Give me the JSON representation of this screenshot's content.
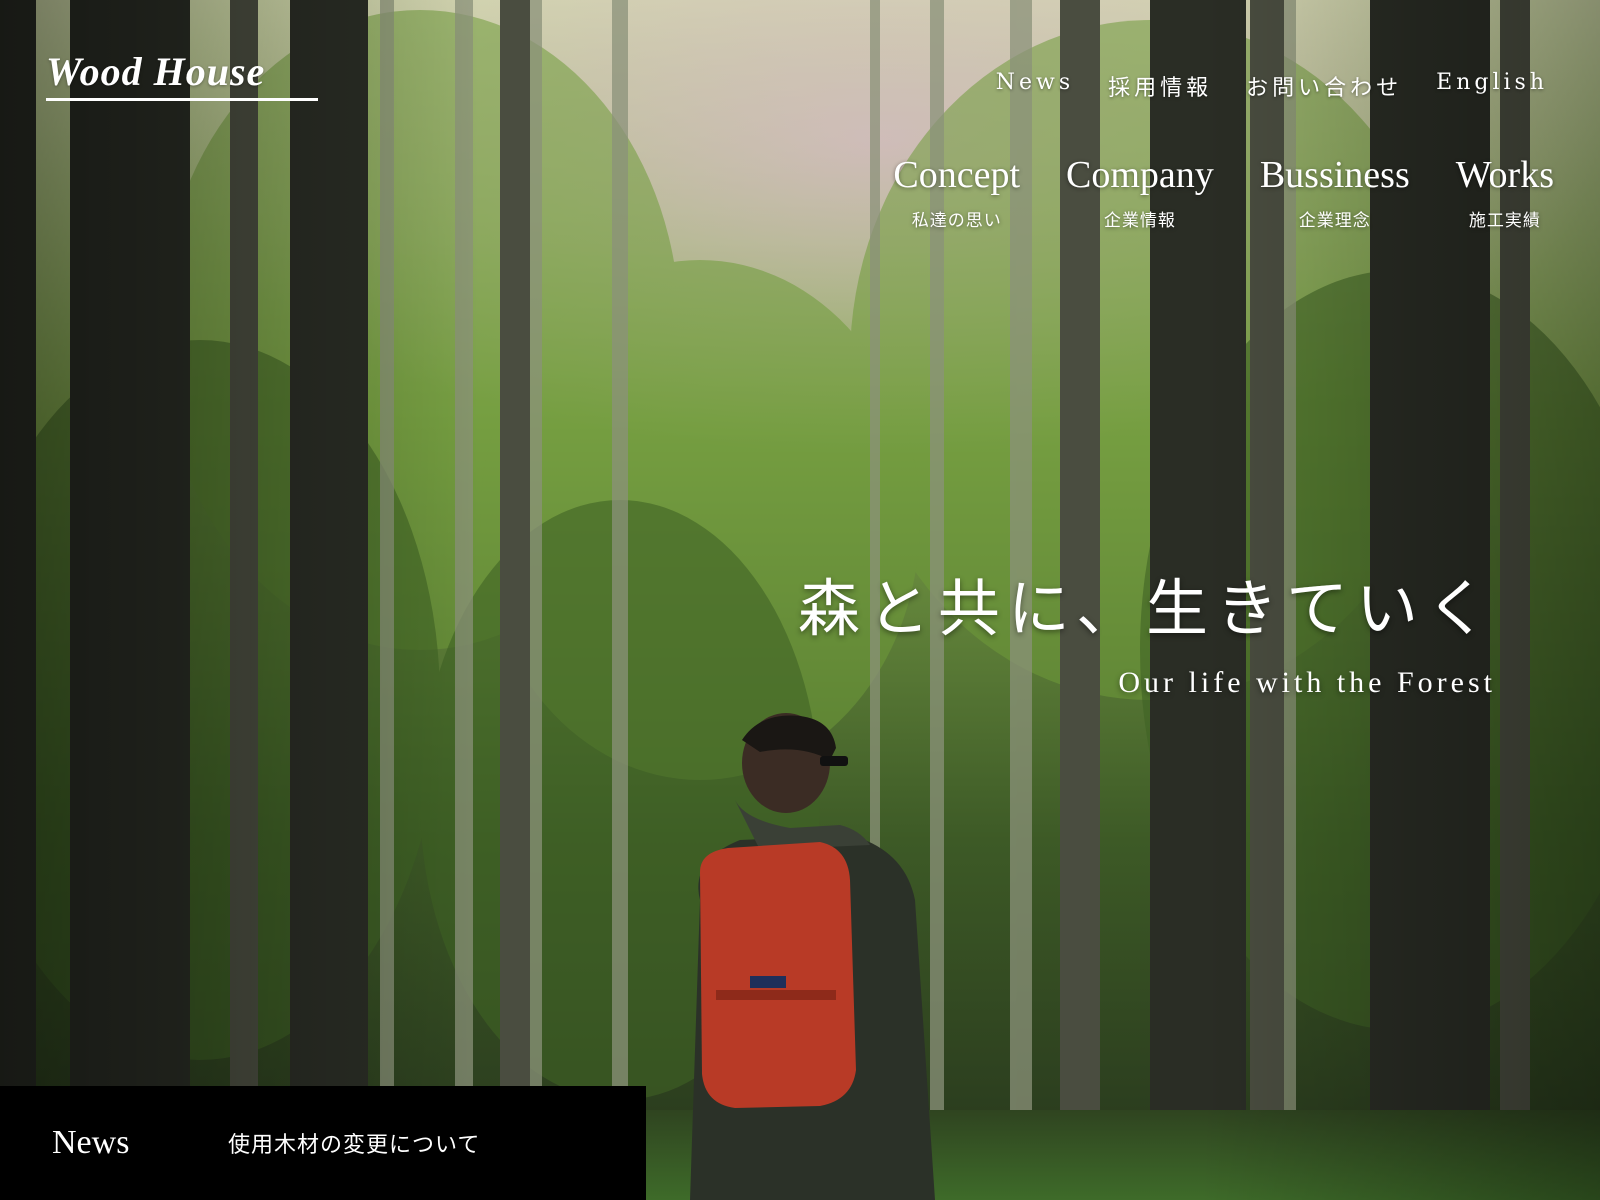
{
  "site": {
    "logo_text": "Wood House"
  },
  "util_nav": [
    {
      "label": "News"
    },
    {
      "label": "採用情報"
    },
    {
      "label": "お問い合わせ"
    },
    {
      "label": "English"
    }
  ],
  "main_nav": [
    {
      "en": "Concept",
      "ja": "私達の思い"
    },
    {
      "en": "Company",
      "ja": "企業情報"
    },
    {
      "en": "Bussiness",
      "ja": "企業理念"
    },
    {
      "en": "Works",
      "ja": "施工実績"
    }
  ],
  "hero": {
    "image": "forest-hiker-photo",
    "headline": "森と共に、生きていく",
    "subline": "Our life with the Forest"
  },
  "news": {
    "label": "News",
    "latest_title": "使用木材の変更について"
  },
  "colors": {
    "text": "#ffffff",
    "news_bar_bg": "#000000",
    "forest_green": "#4f7a2f",
    "trunk_dark": "#2a2d25",
    "backpack_red": "#b83a26"
  }
}
